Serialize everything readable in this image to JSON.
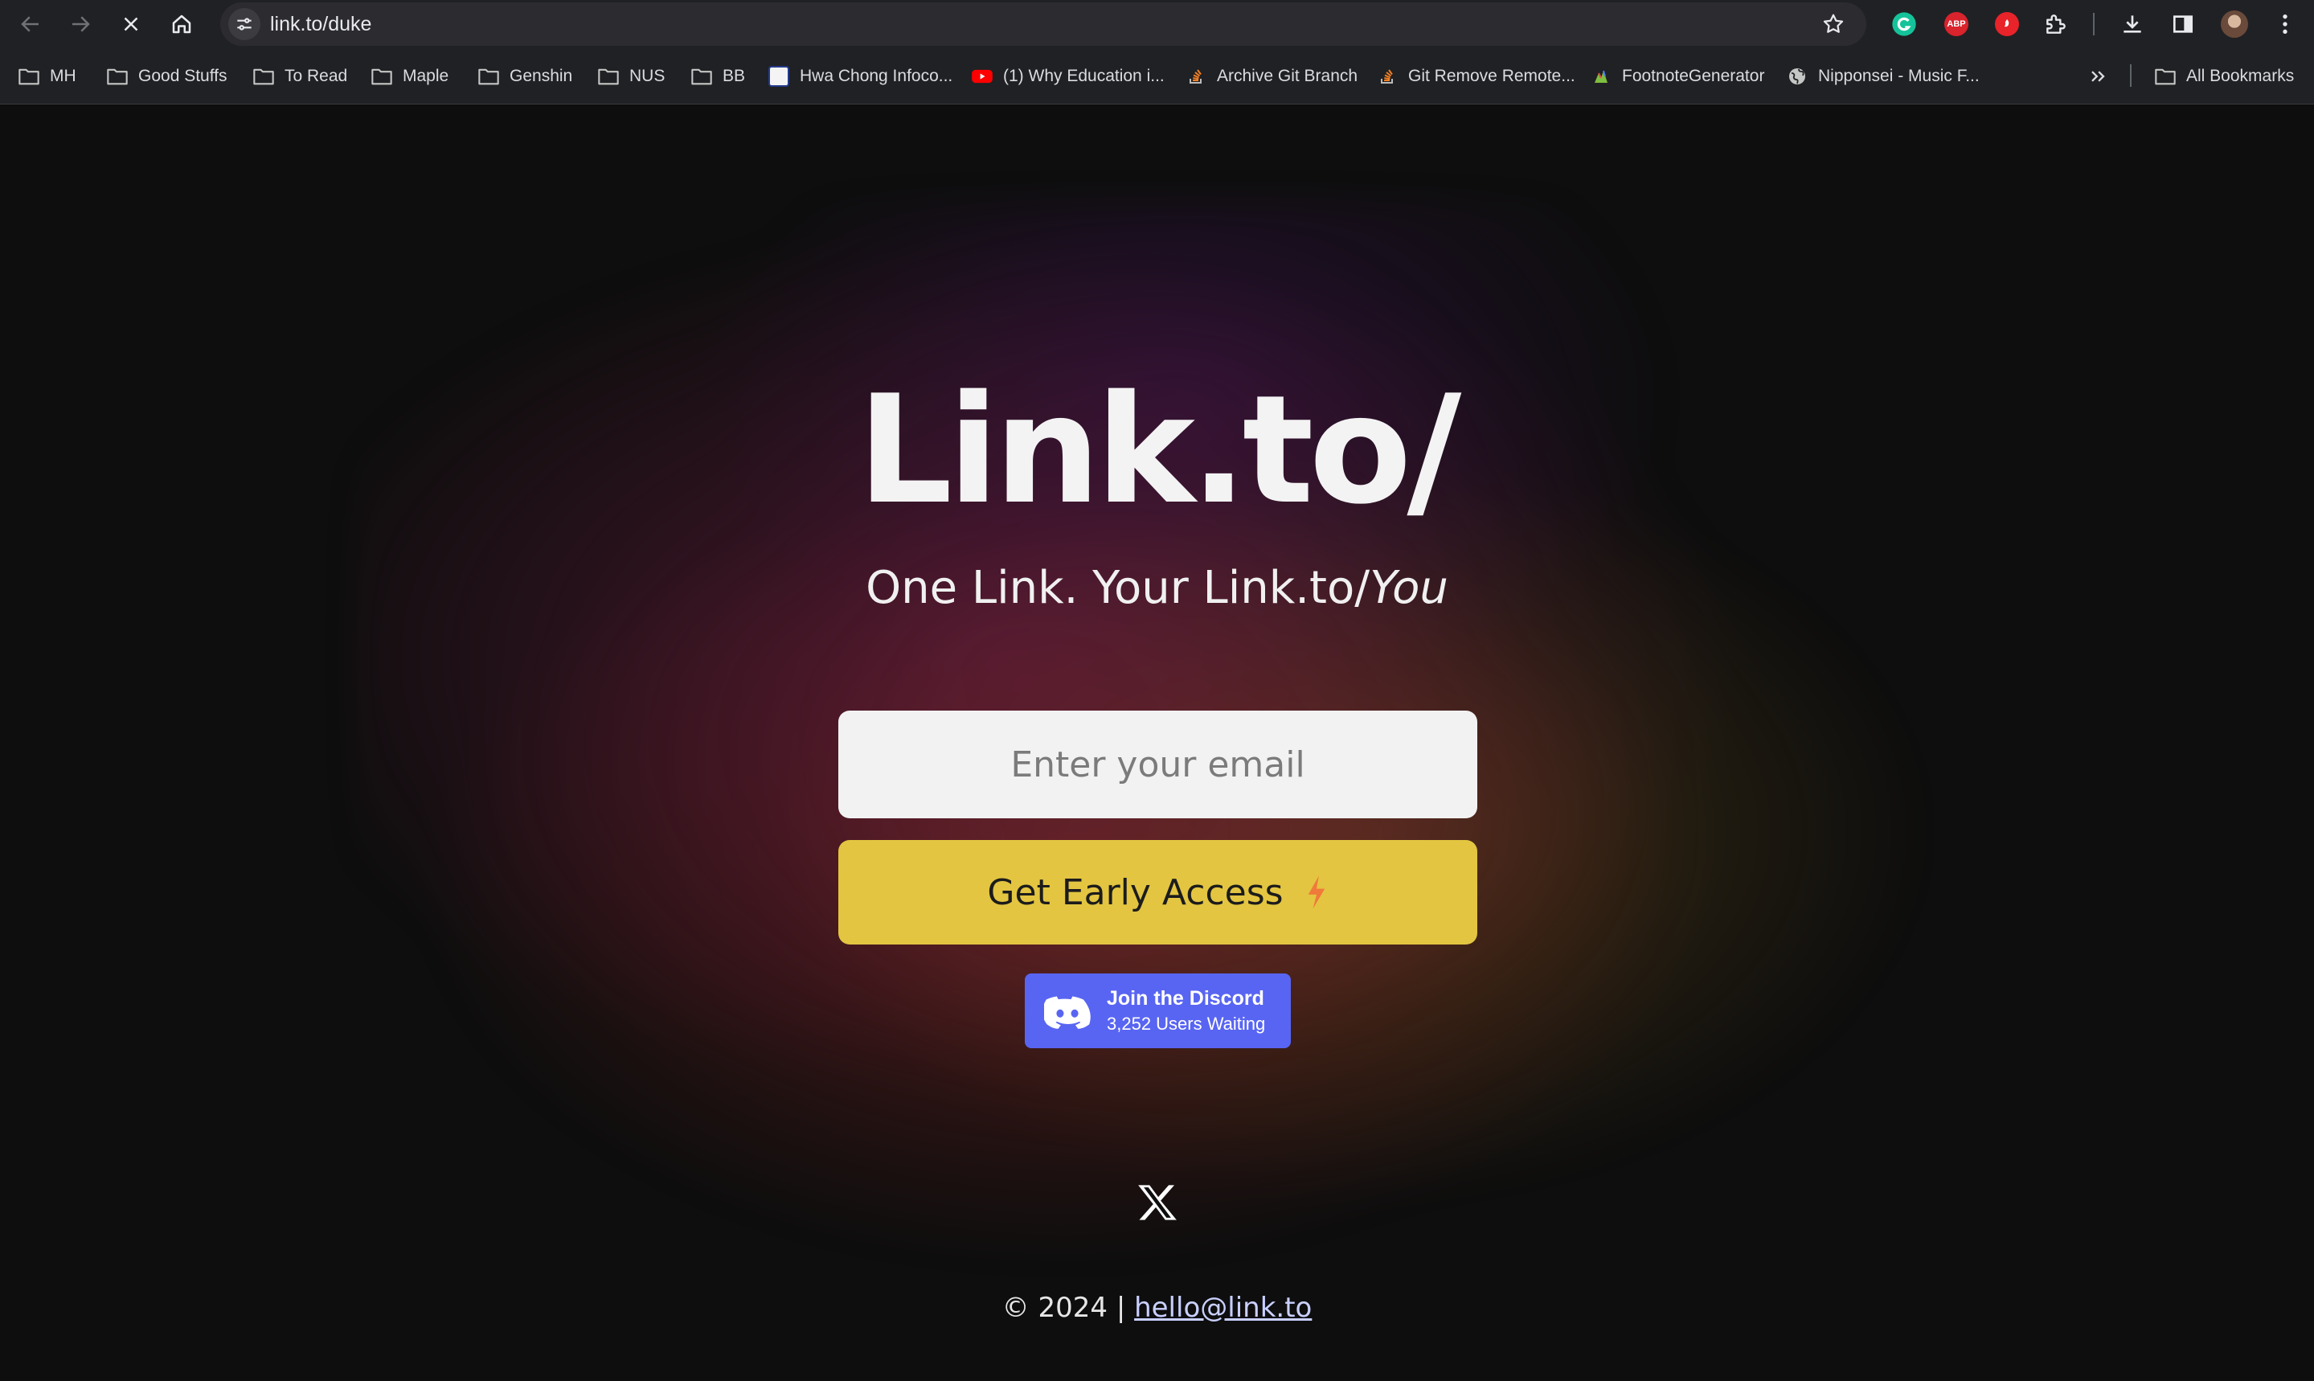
{
  "browser": {
    "url": "link.to/duke",
    "bookmarks": [
      {
        "label": "MH",
        "type": "folder"
      },
      {
        "label": "Good Stuffs",
        "type": "folder"
      },
      {
        "label": "To Read",
        "type": "folder"
      },
      {
        "label": "Maple",
        "type": "folder"
      },
      {
        "label": "Genshin",
        "type": "folder"
      },
      {
        "label": "NUS",
        "type": "folder"
      },
      {
        "label": "BB",
        "type": "folder"
      },
      {
        "label": "Hwa Chong Infoco...",
        "type": "site"
      },
      {
        "label": "(1) Why Education i...",
        "type": "site"
      },
      {
        "label": "Archive Git Branch",
        "type": "site"
      },
      {
        "label": "Git Remove Remote...",
        "type": "site"
      },
      {
        "label": "FootnoteGenerator",
        "type": "site"
      },
      {
        "label": "Nipponsei - Music F...",
        "type": "site"
      }
    ],
    "all_bookmarks_label": "All Bookmarks",
    "extensions": [
      "grammarly-icon",
      "adblock-plus-icon",
      "red-extension-icon",
      "puzzle-icon"
    ]
  },
  "page": {
    "logo": "Link.to/",
    "tagline_main": "One Link. Your Link.to/",
    "tagline_emphasis": "You",
    "email_placeholder": "Enter your email",
    "cta_label": "Get Early Access",
    "discord_title": "Join the Discord",
    "discord_count": "3,252 Users Waiting",
    "footer_text": "© 2024 |",
    "footer_email": "hello@link.to"
  },
  "colors": {
    "background": "#0e0e0e",
    "cta": "#e3c541",
    "discord": "#5865f2",
    "bolt": "#f07a3a"
  }
}
